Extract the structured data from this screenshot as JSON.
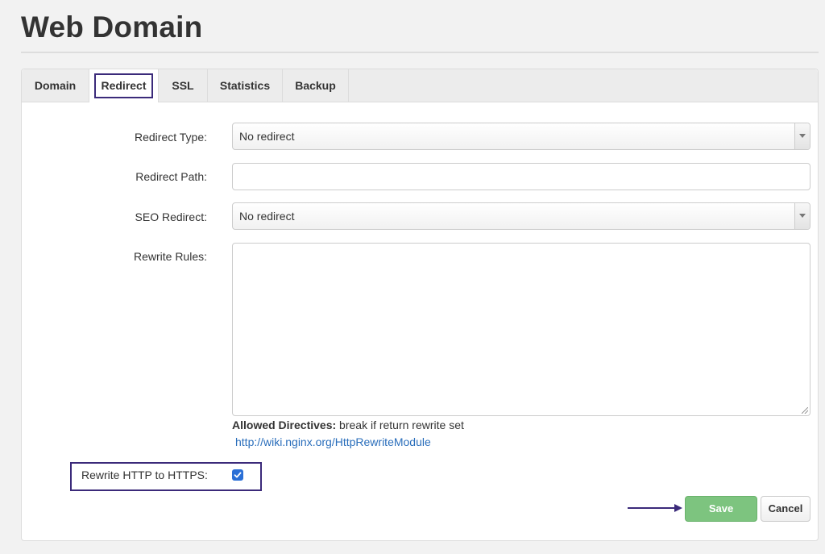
{
  "page": {
    "title": "Web Domain"
  },
  "tabs": [
    {
      "label": "Domain"
    },
    {
      "label": "Redirect",
      "active": true
    },
    {
      "label": "SSL"
    },
    {
      "label": "Statistics"
    },
    {
      "label": "Backup"
    }
  ],
  "form": {
    "redirect_type": {
      "label": "Redirect Type:",
      "value": "No redirect"
    },
    "redirect_path": {
      "label": "Redirect Path:",
      "value": ""
    },
    "seo_redirect": {
      "label": "SEO Redirect:",
      "value": "No redirect"
    },
    "rewrite_rules": {
      "label": "Rewrite Rules:",
      "value": ""
    },
    "allowed_directives": {
      "label": "Allowed Directives:",
      "value": "break if return rewrite set"
    },
    "help_link": "http://wiki.nginx.org/HttpRewriteModule",
    "rewrite_https": {
      "label": "Rewrite HTTP to HTTPS:",
      "checked": true
    }
  },
  "actions": {
    "save": "Save",
    "cancel": "Cancel"
  },
  "colors": {
    "save": "#7dc47f",
    "highlight": "#3b2a7a",
    "link": "#2a6ebb",
    "checkbox": "#2a6fd6"
  },
  "icons": {
    "dropdown": "caret-down-icon",
    "checkbox": "check-icon",
    "arrow": "arrow-right-icon"
  }
}
